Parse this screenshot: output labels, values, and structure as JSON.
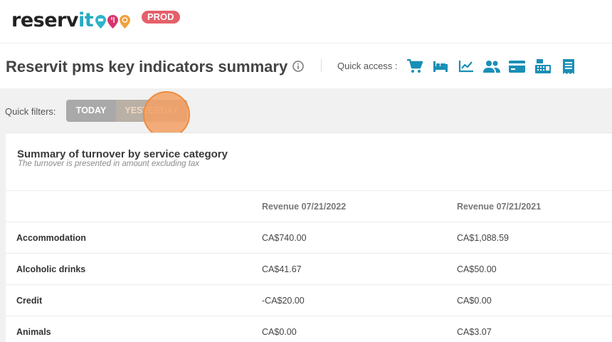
{
  "header": {
    "logo_main": "reservit",
    "logo_accent": "it",
    "logo_prefix": "reserv",
    "env_badge": "PROD",
    "colors": {
      "brand": "#26a9c4",
      "badge": "#e4606a",
      "pin_blue": "#2fb4c9",
      "pin_pink": "#d9336f",
      "pin_orange": "#f0a13c"
    },
    "pins": [
      "location-pin-icon",
      "location-pin-icon",
      "location-pin-icon"
    ]
  },
  "titlebar": {
    "title": "Reservit pms key indicators summary",
    "quick_access_label": "Quick access :",
    "quick_access_icons": [
      "cart-icon",
      "bed-icon",
      "chart-line-icon",
      "users-icon",
      "credit-card-icon",
      "cash-register-icon",
      "receipt-icon"
    ],
    "accent": "#1a8fb5"
  },
  "filters": {
    "label": "Quick filters:",
    "options": [
      "TODAY",
      "YESTERDAY"
    ]
  },
  "summary": {
    "title": "Summary of turnover by service category",
    "subtitle": "The turnover is presented in amount excluding tax",
    "columns": [
      "",
      "Revenue 07/21/2022",
      "Revenue 07/21/2021"
    ],
    "rows": [
      [
        "Accommodation",
        "CA$740.00",
        "CA$1,088.59"
      ],
      [
        "Alcoholic drinks",
        "CA$41.67",
        "CA$50.00"
      ],
      [
        "Credit",
        "-CA$20.00",
        "CA$0.00"
      ],
      [
        "Animals",
        "CA$0.00",
        "CA$3.07"
      ]
    ]
  }
}
